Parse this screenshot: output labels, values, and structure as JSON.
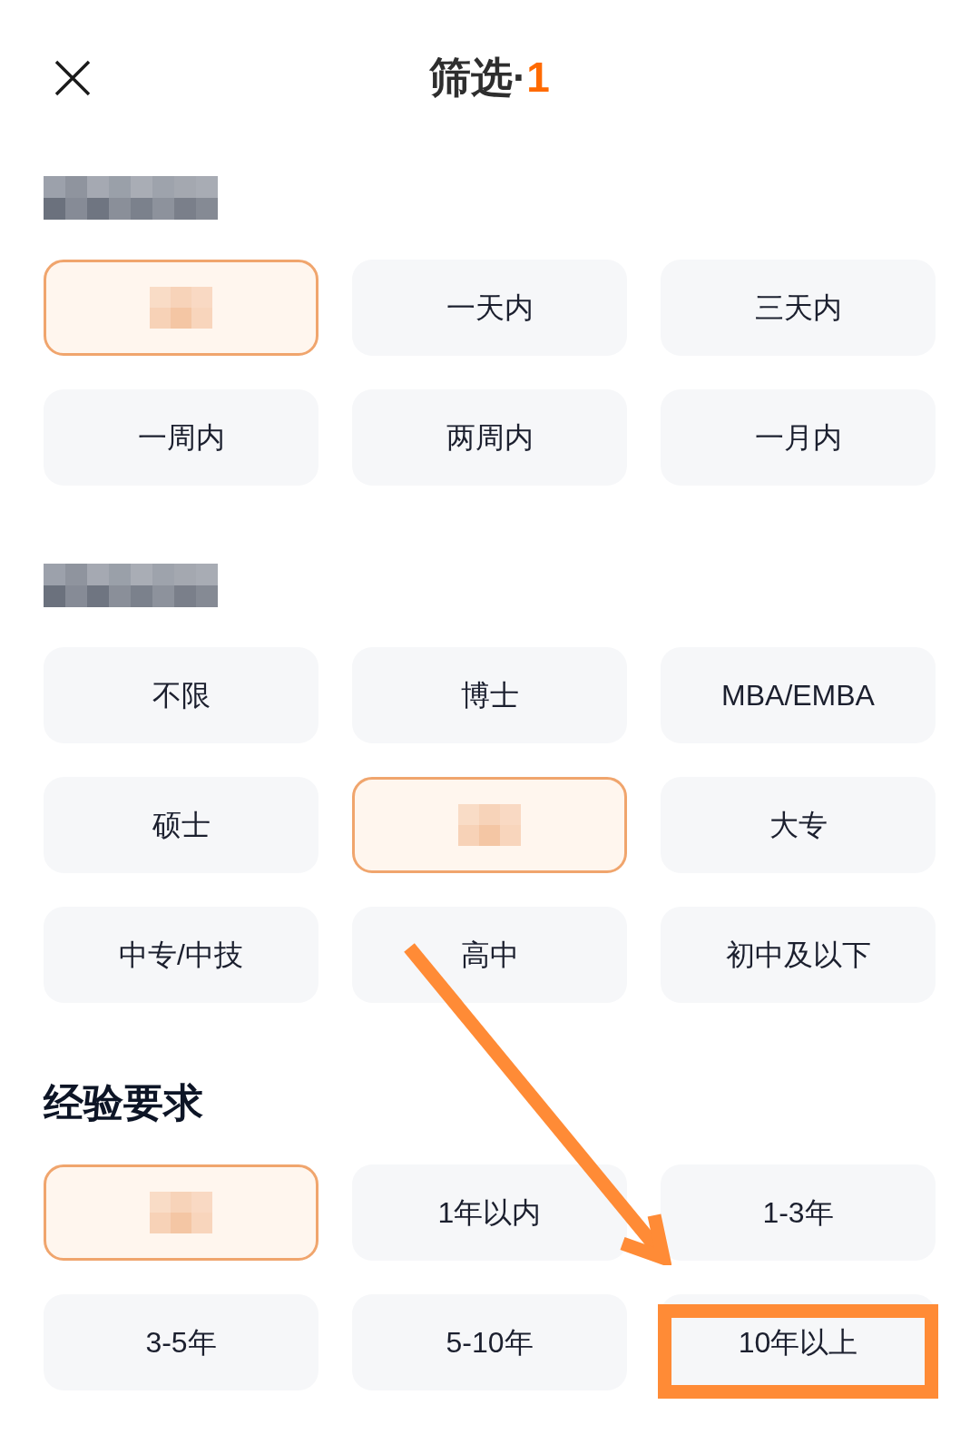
{
  "header": {
    "title": "筛选·",
    "count": "1"
  },
  "sections": [
    {
      "title_pixelated": true,
      "options": [
        {
          "pixelated": true,
          "selected": true,
          "callout": false
        },
        {
          "label": "一天内",
          "pixelated": false,
          "selected": false,
          "callout": false
        },
        {
          "label": "三天内",
          "pixelated": false,
          "selected": false,
          "callout": false
        },
        {
          "label": "一周内",
          "pixelated": false,
          "selected": false,
          "callout": false
        },
        {
          "label": "两周内",
          "pixelated": false,
          "selected": false,
          "callout": false
        },
        {
          "label": "一月内",
          "pixelated": false,
          "selected": false,
          "callout": false
        }
      ]
    },
    {
      "title_pixelated": true,
      "options": [
        {
          "label": "不限",
          "pixelated": false,
          "selected": false,
          "callout": false
        },
        {
          "label": "博士",
          "pixelated": false,
          "selected": false,
          "callout": false
        },
        {
          "label": "MBA/EMBA",
          "pixelated": false,
          "selected": false,
          "callout": false
        },
        {
          "label": "硕士",
          "pixelated": false,
          "selected": false,
          "callout": false
        },
        {
          "pixelated": true,
          "selected": true,
          "callout": false
        },
        {
          "label": "大专",
          "pixelated": false,
          "selected": false,
          "callout": false
        },
        {
          "label": "中专/中技",
          "pixelated": false,
          "selected": false,
          "callout": false
        },
        {
          "label": "高中",
          "pixelated": false,
          "selected": false,
          "callout": false
        },
        {
          "label": "初中及以下",
          "pixelated": false,
          "selected": false,
          "callout": false
        }
      ]
    },
    {
      "title": "经验要求",
      "title_pixelated": false,
      "options": [
        {
          "pixelated": true,
          "selected": true,
          "callout": false
        },
        {
          "label": "1年以内",
          "pixelated": false,
          "selected": false,
          "callout": false
        },
        {
          "label": "1-3年",
          "pixelated": false,
          "selected": false,
          "callout": false
        },
        {
          "label": "3-5年",
          "pixelated": false,
          "selected": false,
          "callout": false
        },
        {
          "label": "5-10年",
          "pixelated": false,
          "selected": false,
          "callout": false
        },
        {
          "label": "10年以上",
          "pixelated": false,
          "selected": false,
          "callout": true
        }
      ]
    }
  ]
}
